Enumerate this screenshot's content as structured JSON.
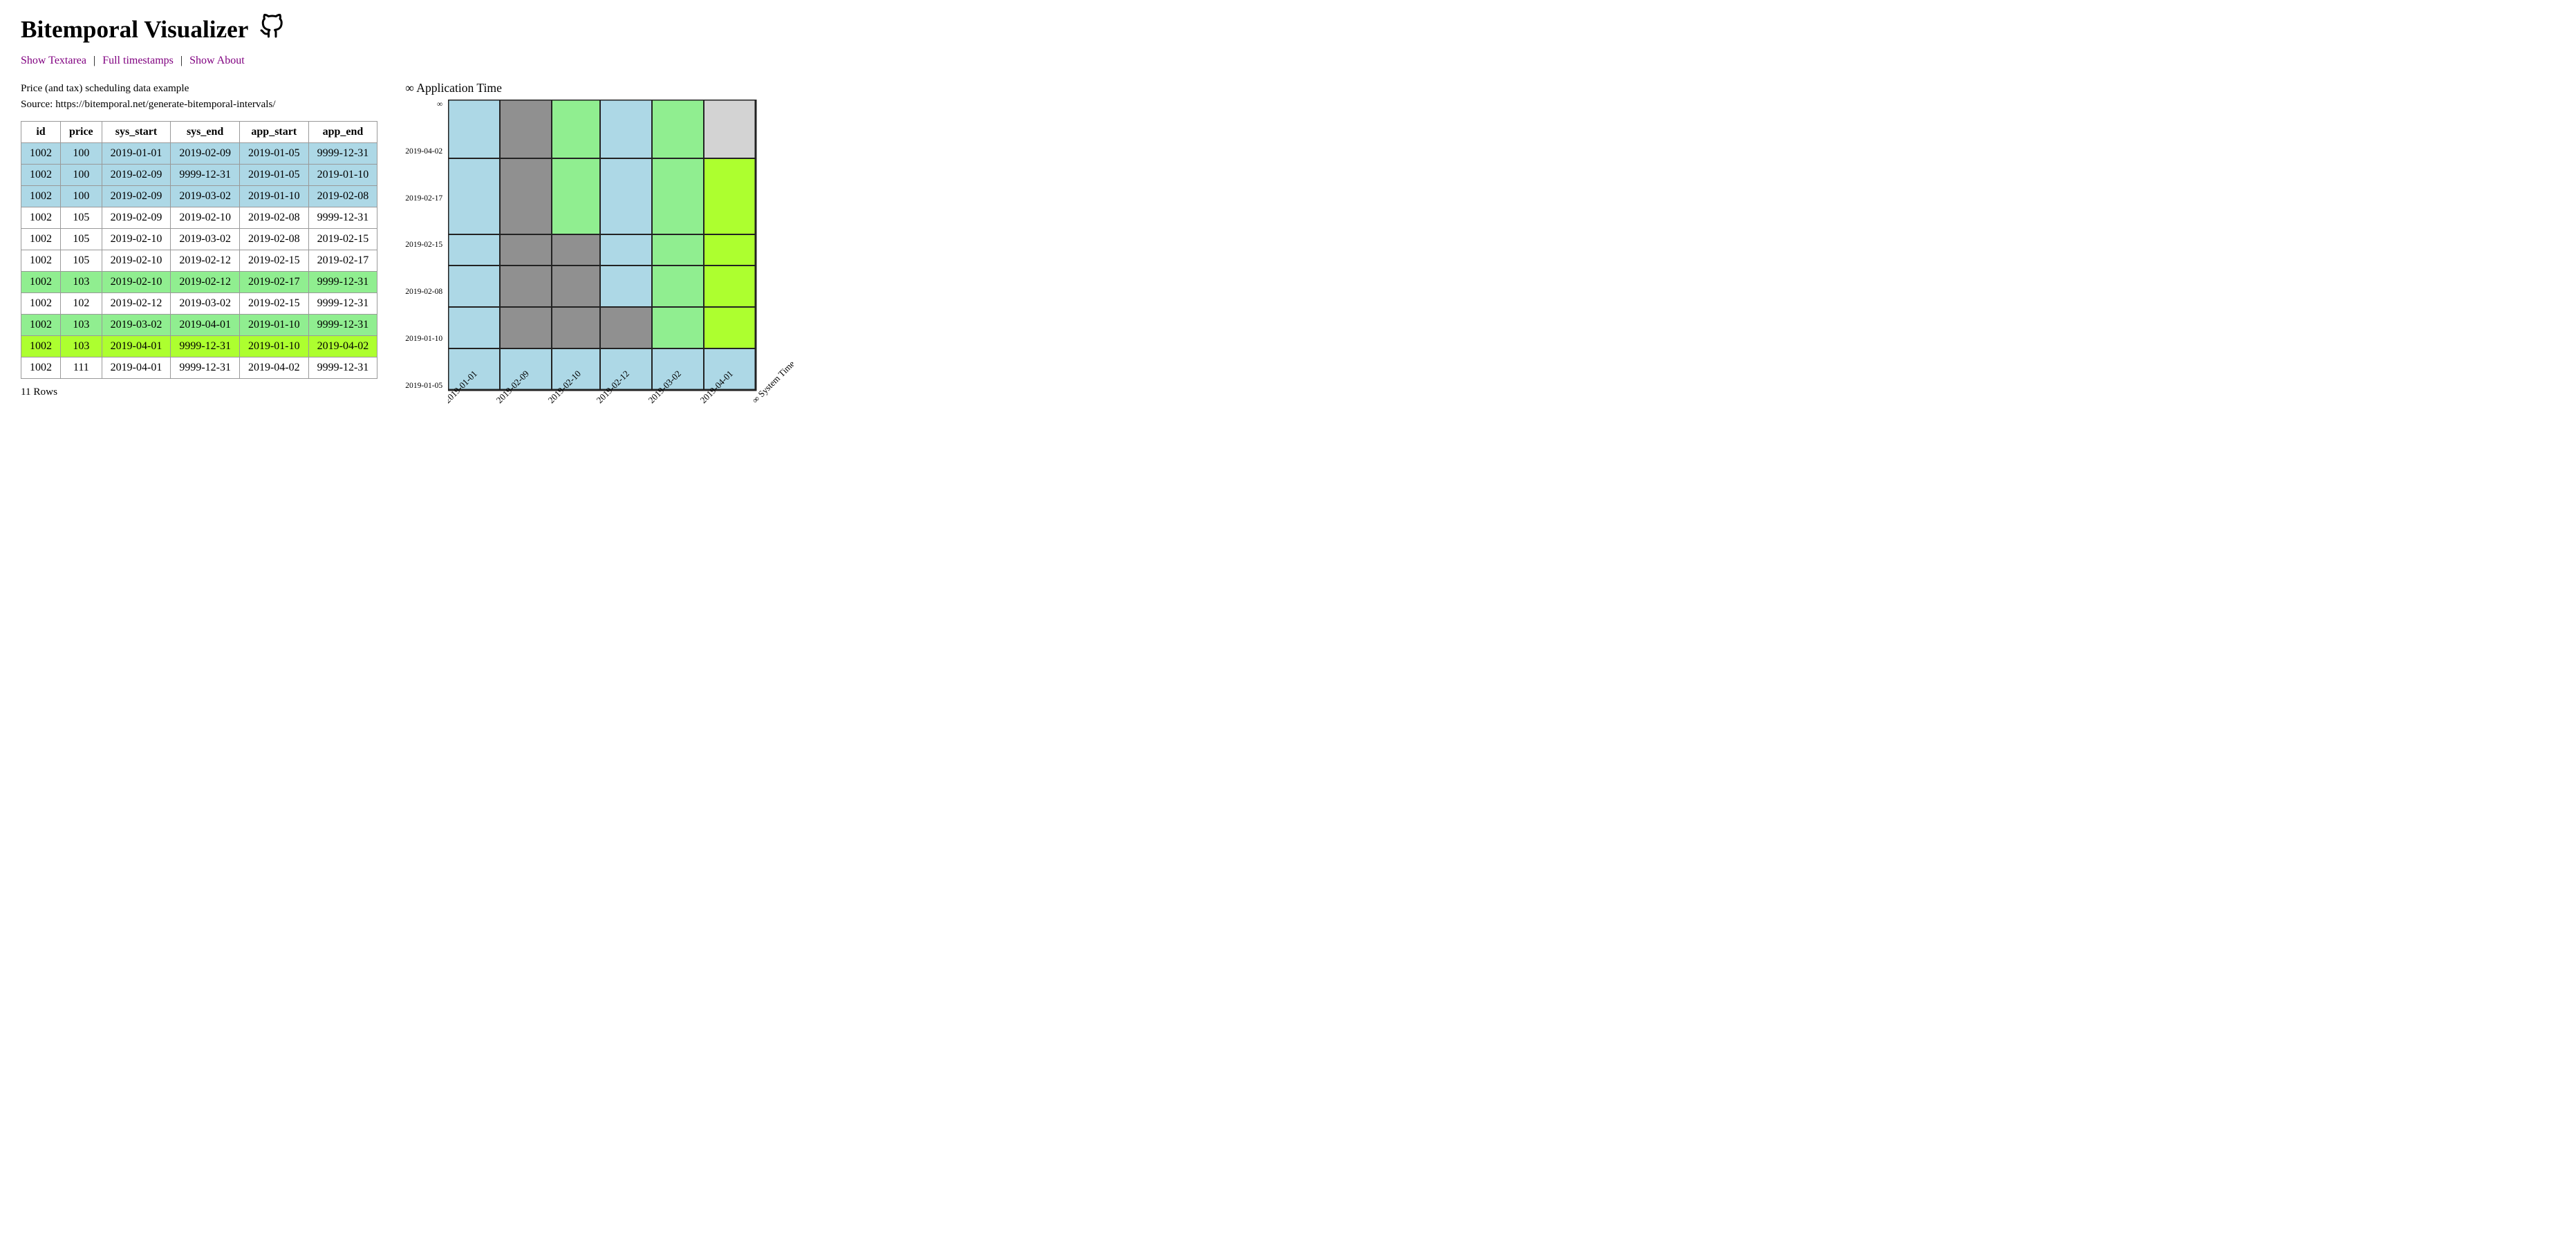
{
  "app": {
    "title": "Bitemporal Visualizer",
    "github_icon": "⊙"
  },
  "nav": {
    "show_textarea": "Show Textarea",
    "full_timestamps": "Full timestamps",
    "show_about": "Show About",
    "sep": "|"
  },
  "data_description": {
    "line1": "Price (and tax) scheduling data example",
    "line2": "Source: https://bitemporal.net/generate-bitemporal-intervals/"
  },
  "table": {
    "headers": [
      "id",
      "price",
      "sys_start",
      "sys_end",
      "app_start",
      "app_end"
    ],
    "rows": [
      {
        "id": "1002",
        "price": "100",
        "sys_start": "2019-01-01",
        "sys_end": "2019-02-09",
        "app_start": "2019-01-05",
        "app_end": "9999-12-31",
        "color": "blue"
      },
      {
        "id": "1002",
        "price": "100",
        "sys_start": "2019-02-09",
        "sys_end": "9999-12-31",
        "app_start": "2019-01-05",
        "app_end": "2019-01-10",
        "color": "blue"
      },
      {
        "id": "1002",
        "price": "100",
        "sys_start": "2019-02-09",
        "sys_end": "2019-03-02",
        "app_start": "2019-01-10",
        "app_end": "2019-02-08",
        "color": "blue"
      },
      {
        "id": "1002",
        "price": "105",
        "sys_start": "2019-02-09",
        "sys_end": "2019-02-10",
        "app_start": "2019-02-08",
        "app_end": "9999-12-31",
        "color": "white"
      },
      {
        "id": "1002",
        "price": "105",
        "sys_start": "2019-02-10",
        "sys_end": "2019-03-02",
        "app_start": "2019-02-08",
        "app_end": "2019-02-15",
        "color": "white"
      },
      {
        "id": "1002",
        "price": "105",
        "sys_start": "2019-02-10",
        "sys_end": "2019-02-12",
        "app_start": "2019-02-15",
        "app_end": "2019-02-17",
        "color": "white"
      },
      {
        "id": "1002",
        "price": "103",
        "sys_start": "2019-02-10",
        "sys_end": "2019-02-12",
        "app_start": "2019-02-17",
        "app_end": "9999-12-31",
        "color": "green"
      },
      {
        "id": "1002",
        "price": "102",
        "sys_start": "2019-02-12",
        "sys_end": "2019-03-02",
        "app_start": "2019-02-15",
        "app_end": "9999-12-31",
        "color": "white"
      },
      {
        "id": "1002",
        "price": "103",
        "sys_start": "2019-03-02",
        "sys_end": "2019-04-01",
        "app_start": "2019-01-10",
        "app_end": "9999-12-31",
        "color": "green"
      },
      {
        "id": "1002",
        "price": "103",
        "sys_start": "2019-04-01",
        "sys_end": "9999-12-31",
        "app_start": "2019-01-10",
        "app_end": "2019-04-02",
        "color": "bright"
      },
      {
        "id": "1002",
        "price": "111",
        "sys_start": "2019-04-01",
        "sys_end": "9999-12-31",
        "app_start": "2019-04-02",
        "app_end": "9999-12-31",
        "color": "white"
      }
    ],
    "row_count": "11 Rows"
  },
  "chart": {
    "app_time_label": "∞ Application Time",
    "system_time_label": "∞ System Time",
    "x_labels": [
      "2019-01-01",
      "2019-02-09",
      "2019-02-10",
      "2019-02-12",
      "2019-03-02",
      "2019-04-01",
      "∞ System Time"
    ],
    "y_labels": [
      "2019-01-05",
      "2019-01-10",
      "2019-02-08",
      "2019-02-15",
      "2019-02-17",
      "2019-04-02",
      "∞"
    ]
  }
}
